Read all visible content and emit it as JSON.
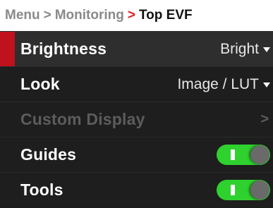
{
  "breadcrumb": {
    "items": [
      "Menu",
      "Monitoring",
      "Top EVF"
    ],
    "separator": ">"
  },
  "menu": {
    "items": [
      {
        "label": "Brightness",
        "value": "Bright",
        "control": "dropdown",
        "selected": true,
        "enabled": true
      },
      {
        "label": "Look",
        "value": "Image / LUT",
        "control": "dropdown",
        "selected": false,
        "enabled": true
      },
      {
        "label": "Custom Display",
        "value": ">",
        "control": "submenu",
        "selected": false,
        "enabled": false
      },
      {
        "label": "Guides",
        "control": "toggle",
        "state": "on",
        "selected": false,
        "enabled": true
      },
      {
        "label": "Tools",
        "control": "toggle",
        "state": "on",
        "selected": false,
        "enabled": true
      }
    ]
  },
  "colors": {
    "accent_red": "#c0121c",
    "toggle_on": "#2fd12f",
    "background": "#1e1e1e",
    "breadcrumb_bg": "#ffffff"
  }
}
